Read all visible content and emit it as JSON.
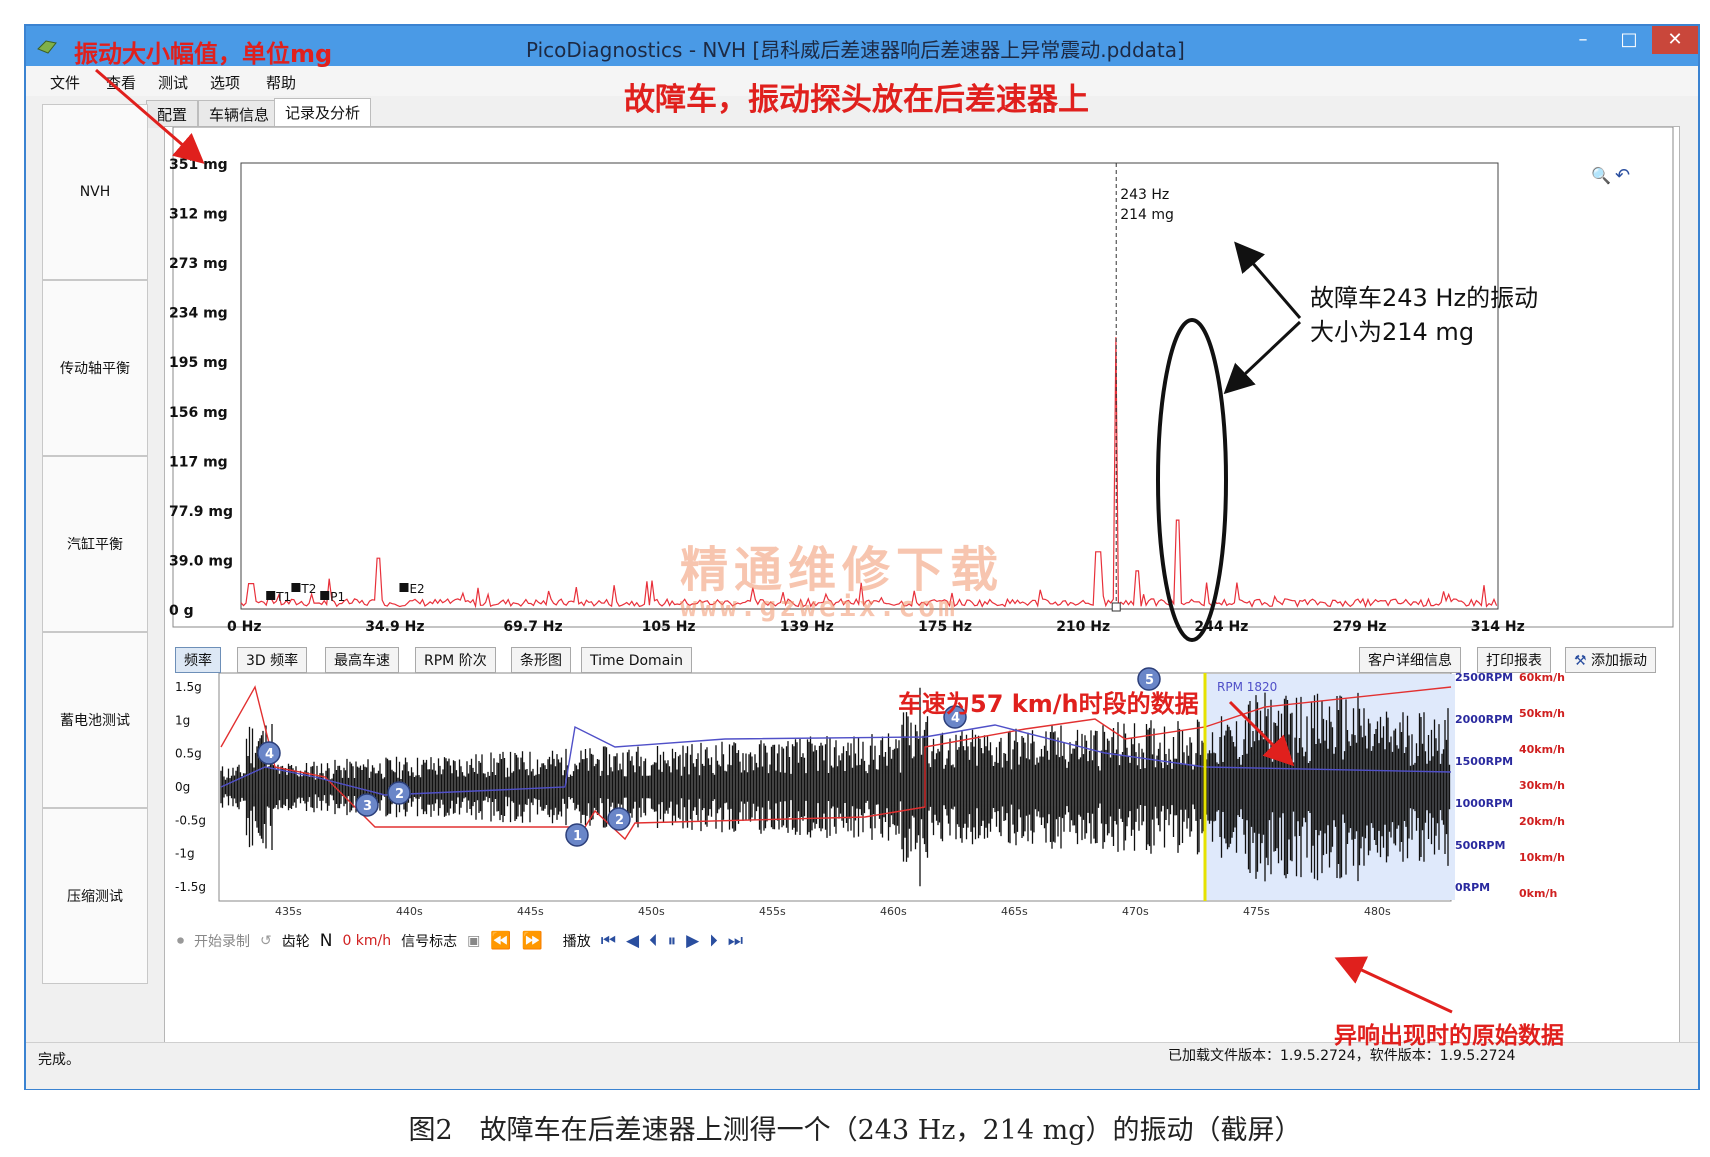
{
  "window": {
    "title": "PicoDiagnostics - NVH [昂科威后差速器响后差速器上异常震动.pddata]",
    "minimize_label": "–",
    "maximize_label": "□",
    "close_label": "✕"
  },
  "menu": [
    "文件",
    "查看",
    "测试",
    "选项",
    "帮助"
  ],
  "tabs": [
    "配置",
    "车辆信息",
    "记录及分析"
  ],
  "sidebar": [
    "NVH",
    "传动轴平衡",
    "汽缸平衡",
    "蓄电池测试",
    "压缩测试"
  ],
  "spectrum": {
    "y_ticks": [
      "351 mg",
      "312 mg",
      "273 mg",
      "234 mg",
      "195 mg",
      "156 mg",
      "117 mg",
      "77.9 mg",
      "39.0 mg",
      "0 g"
    ],
    "x_ticks": [
      "0 Hz",
      "34.9 Hz",
      "69.7 Hz",
      "105 Hz",
      "139 Hz",
      "175 Hz",
      "210 Hz",
      "244 Hz",
      "279 Hz",
      "314 Hz"
    ],
    "cursor_freq": "243 Hz",
    "cursor_amp": "214 mg",
    "markers": [
      "T1",
      "T2",
      "P1",
      "E2"
    ],
    "peak_hz": 243,
    "peak_mg": 214,
    "y_max_mg": 351,
    "x_max_hz": 349
  },
  "view_buttons": [
    "频率",
    "3D 频率",
    "最高车速",
    "RPM 阶次",
    "条形图",
    "Time Domain"
  ],
  "action_buttons": [
    "客户详细信息",
    "打印报表",
    "添加振动"
  ],
  "timeline": {
    "y_ticks": [
      "1.5g",
      "1g",
      "0.5g",
      "0g",
      "-0.5g",
      "-1g",
      "-1.5g"
    ],
    "x_ticks": [
      "435s",
      "440s",
      "445s",
      "450s",
      "455s",
      "460s",
      "465s",
      "470s",
      "475s",
      "480s"
    ],
    "rpm_ticks": [
      "2500RPM",
      "2000RPM",
      "1500RPM",
      "1000RPM",
      "500RPM",
      "0RPM"
    ],
    "speed_ticks": [
      "60km/h",
      "50km/h",
      "40km/h",
      "30km/h",
      "20km/h",
      "10km/h",
      "0km/h"
    ],
    "badges": [
      "4",
      "3",
      "2",
      "1",
      "2",
      "4",
      "5"
    ],
    "cursor_label": "RPM 1820"
  },
  "playback": {
    "record_label": "开始录制",
    "gear_label": "齿轮",
    "gear_value": "N",
    "speed_value": "0 km/h",
    "signal_label": "信号标志",
    "play_label": "播放"
  },
  "status": {
    "left": "完成。",
    "right": "已加载文件版本：1.9.5.2724，软件版本：1.9.5.2724"
  },
  "annotations": {
    "amplitude_unit": "振动大小幅值，单位mg",
    "fault_probe": "故障车，振动探头放在后差速器上",
    "vibration_note_1": "故障车243 Hz的振动",
    "vibration_note_2": "大小为214 mg",
    "speed_segment": "车速为57 km/h时段的数据",
    "raw_data": "异响出现时的原始数据"
  },
  "watermark": {
    "cn": "精通维修下载",
    "url": "www.gzweix.com"
  },
  "caption": "图2　故障车在后差速器上测得一个（243 Hz，214 mg）的振动（截屏）"
}
